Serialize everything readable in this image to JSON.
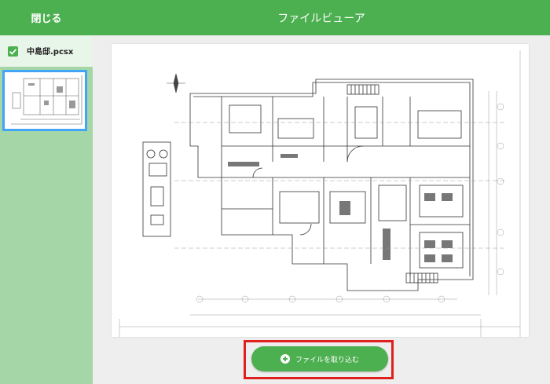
{
  "header": {
    "close_label": "閉じる",
    "title": "ファイルビューア"
  },
  "sidebar": {
    "file": {
      "checked": true,
      "name": "中島邸.pcsx"
    }
  },
  "main": {
    "import_button": {
      "label": "ファイルを取り込む",
      "icon": "plus-circle-icon"
    }
  },
  "colors": {
    "header": "#4caf50",
    "sidebar": "#a5d6a7",
    "thumbnail_border": "#42a5f5",
    "highlight": "#e0201f"
  }
}
